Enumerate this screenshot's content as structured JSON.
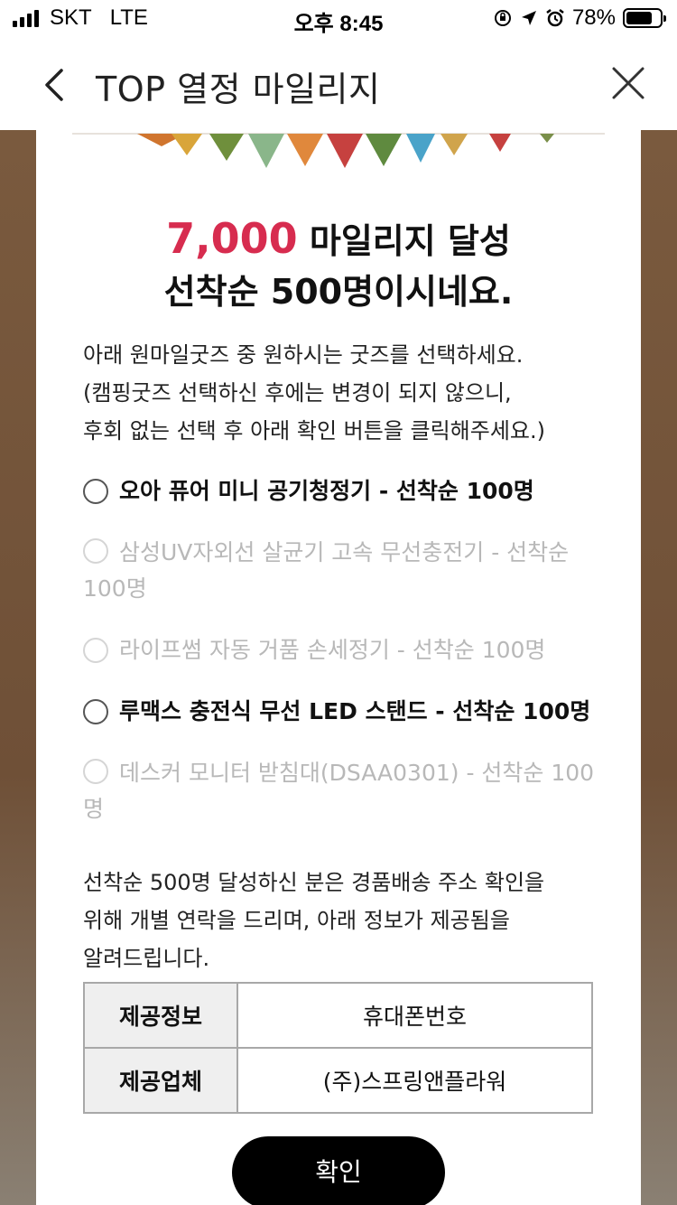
{
  "status_bar": {
    "carrier": "SKT",
    "network": "LTE",
    "time": "오후 8:45",
    "battery_percent": "78%",
    "battery_level": 0.78
  },
  "header": {
    "title": "TOP 열정 마일리지",
    "back_icon": "chevron-left-icon",
    "close_icon": "close-icon"
  },
  "headline": {
    "amount": "7,000",
    "line1_rest": " 마일리지 달성",
    "line2": "선착순 500명이시네요."
  },
  "intro": {
    "line1": "아래 원마일굿즈 중 원하시는 굿즈를 선택하세요.",
    "line2": "(캠핑굿즈 선택하신 후에는 변경이 되지 않으니,",
    "line3": "후회 없는 선택 후 아래 확인 버튼을 클릭해주세요.)"
  },
  "options": [
    {
      "label": "오아 퓨어 미니 공기청정기 - 선착순 100명",
      "enabled": true
    },
    {
      "label": "삼성UV자외선 살균기 고속 무선충전기 - 선착순 100명",
      "enabled": false
    },
    {
      "label": "라이프썸 자동 거품 손세정기 - 선착순 100명",
      "enabled": false
    },
    {
      "label": "루맥스 충전식 무선 LED 스탠드 - 선착순 100명",
      "enabled": true
    },
    {
      "label": "데스커 모니터 받침대(DSAA0301) - 선착순 100명",
      "enabled": false
    }
  ],
  "notice": {
    "line1": "선착순 500명 달성하신 분은 경품배송 주소 확인을",
    "line2": "위해 개별 연락을 드리며, 아래 정보가 제공됨을",
    "line3": "알려드립니다."
  },
  "info_table": [
    {
      "label": "제공정보",
      "value": "휴대폰번호"
    },
    {
      "label": "제공업체",
      "value": "(주)스프링앤플라워"
    }
  ],
  "confirm_label": "확인",
  "colors": {
    "accent": "#d72c4f",
    "button": "#000000",
    "background": "#7a5a3e"
  }
}
